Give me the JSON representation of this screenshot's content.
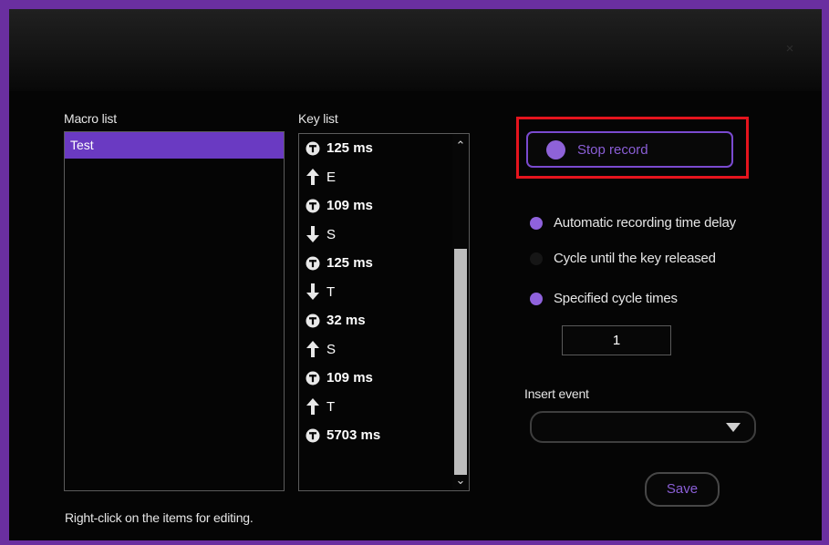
{
  "window": {
    "close_glyph": "×"
  },
  "macro_list": {
    "label": "Macro list",
    "items": [
      {
        "label": "Test",
        "selected": true
      }
    ]
  },
  "key_list": {
    "label": "Key list",
    "items": [
      {
        "type": "delay",
        "icon": "clock-icon",
        "text": "125 ms"
      },
      {
        "type": "key-up",
        "icon": "arrow-up-icon",
        "text": "E"
      },
      {
        "type": "delay",
        "icon": "clock-icon",
        "text": "109 ms"
      },
      {
        "type": "key-down",
        "icon": "arrow-down-icon",
        "text": "S"
      },
      {
        "type": "delay",
        "icon": "clock-icon",
        "text": "125 ms"
      },
      {
        "type": "key-down",
        "icon": "arrow-down-icon",
        "text": "T"
      },
      {
        "type": "delay",
        "icon": "clock-icon",
        "text": "32 ms"
      },
      {
        "type": "key-up",
        "icon": "arrow-up-icon",
        "text": "S"
      },
      {
        "type": "delay",
        "icon": "clock-icon",
        "text": "109 ms"
      },
      {
        "type": "key-up",
        "icon": "arrow-up-icon",
        "text": "T"
      },
      {
        "type": "delay",
        "icon": "clock-icon",
        "text": "5703 ms"
      }
    ]
  },
  "record_button": {
    "label": "Stop record",
    "highlighted": true
  },
  "options": [
    {
      "label": "Automatic recording time delay",
      "selected": true
    },
    {
      "label": "Cycle until the key released",
      "selected": false
    },
    {
      "label": "Specified cycle times",
      "selected": true
    }
  ],
  "cycle_times": {
    "value": "1"
  },
  "insert_event": {
    "label": "Insert event",
    "value": ""
  },
  "save_button": {
    "label": "Save"
  },
  "hint": {
    "text": "Right-click on the items for editing."
  },
  "colors": {
    "accent": "#8e62d8",
    "selection": "#6a3ac2",
    "highlight_border": "#e5141d",
    "frame": "#6a2fa0",
    "background": "#050505"
  }
}
